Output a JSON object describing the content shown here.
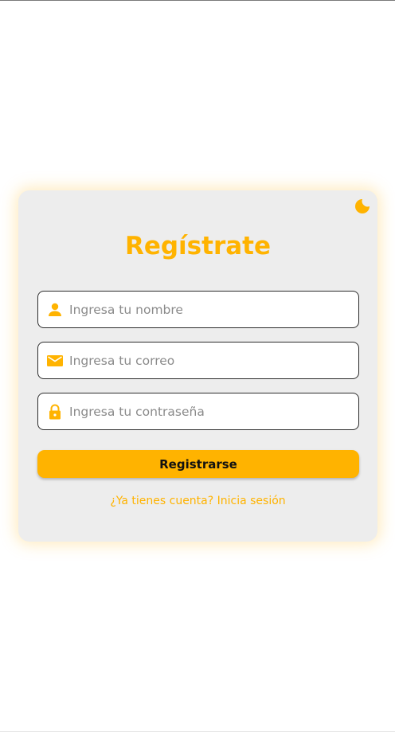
{
  "colors": {
    "accent": "#ffb300",
    "card_background": "#ededed",
    "page_background": "#ffffff",
    "input_border": "#2c2c2c",
    "button_text": "#111111"
  },
  "theme_toggle": {
    "icon": "moon-icon"
  },
  "form": {
    "title": "Regístrate",
    "fields": [
      {
        "icon": "user-icon",
        "placeholder": "Ingresa tu nombre",
        "value": ""
      },
      {
        "icon": "mail-icon",
        "placeholder": "Ingresa tu correo",
        "value": ""
      },
      {
        "icon": "lock-icon",
        "placeholder": "Ingresa tu contraseña",
        "value": ""
      }
    ],
    "submit_label": "Registrarse",
    "login_link": "¿Ya tienes cuenta? Inicia sesión"
  }
}
